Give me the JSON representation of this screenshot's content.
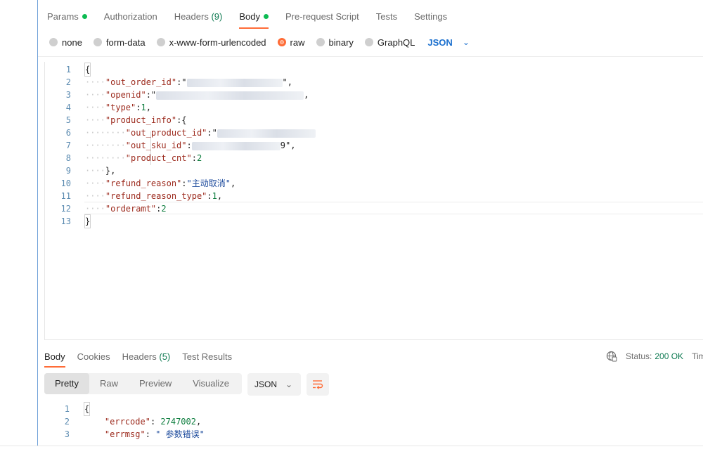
{
  "request_tabs": [
    {
      "label": "Params",
      "dot": true
    },
    {
      "label": "Authorization"
    },
    {
      "label": "Headers",
      "count": "(9)"
    },
    {
      "label": "Body",
      "dot": true,
      "active": true
    },
    {
      "label": "Pre-request Script"
    },
    {
      "label": "Tests"
    },
    {
      "label": "Settings"
    }
  ],
  "body_types": {
    "options": [
      "none",
      "form-data",
      "x-www-form-urlencoded",
      "raw",
      "binary",
      "GraphQL"
    ],
    "selected": "raw",
    "format": "JSON"
  },
  "request_body": {
    "line_numbers": [
      "1",
      "2",
      "3",
      "4",
      "5",
      "6",
      "7",
      "8",
      "9",
      "10",
      "11",
      "12",
      "13"
    ],
    "keys": {
      "out_order_id": "\"out_order_id\"",
      "openid": "\"openid\"",
      "type": "\"type\"",
      "product_info": "\"product_info\"",
      "out_product_id": "\"out_product_id\"",
      "out_sku_id": "\"out_sku_id\"",
      "product_cnt": "\"product_cnt\"",
      "refund_reason": "\"refund_reason\"",
      "refund_reason_type": "\"refund_reason_type\"",
      "orderamt": "\"orderamt\""
    },
    "values": {
      "type": "1",
      "product_cnt": "2",
      "refund_reason": "\"主动取消\"",
      "refund_reason_type": "1",
      "orderamt": "2",
      "out_sku_id_tail": "9\""
    }
  },
  "response_tabs": [
    {
      "label": "Body",
      "active": true
    },
    {
      "label": "Cookies"
    },
    {
      "label": "Headers",
      "count": "(5)"
    },
    {
      "label": "Test Results"
    }
  ],
  "response_status": {
    "label": "Status:",
    "code": "200 OK",
    "time_label": "Tim"
  },
  "response_views": [
    "Pretty",
    "Raw",
    "Preview",
    "Visualize"
  ],
  "response_format": "JSON",
  "response_body": {
    "line_numbers": [
      "1",
      "2",
      "3"
    ],
    "errcode_key": "\"errcode\"",
    "errcode_value": "2747002",
    "errmsg_key": "\"errmsg\"",
    "errmsg_value": "\" 参数错误\""
  },
  "icons": {
    "dot_color": "#0cbb52",
    "accent": "#ff6c37",
    "json_blue": "#1a6fce"
  }
}
